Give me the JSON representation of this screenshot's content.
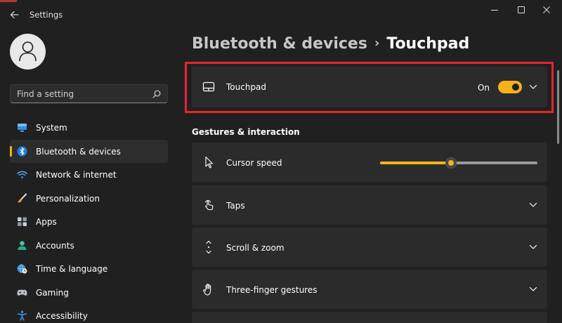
{
  "window": {
    "title": "Settings",
    "back_icon": "back-arrow-icon",
    "controls": [
      "minimize-icon",
      "maximize-icon",
      "close-icon"
    ]
  },
  "sidebar": {
    "avatar_icon": "user-icon",
    "search": {
      "placeholder": "Find a setting",
      "icon": "search-icon"
    },
    "items": [
      {
        "label": "System",
        "icon": "monitor-icon",
        "active": false
      },
      {
        "label": "Bluetooth & devices",
        "icon": "bluetooth-icon",
        "active": true
      },
      {
        "label": "Network & internet",
        "icon": "wifi-icon",
        "active": false
      },
      {
        "label": "Personalization",
        "icon": "brush-icon",
        "active": false
      },
      {
        "label": "Apps",
        "icon": "apps-icon",
        "active": false
      },
      {
        "label": "Accounts",
        "icon": "person-icon",
        "active": false
      },
      {
        "label": "Time & language",
        "icon": "globe-clock-icon",
        "active": false
      },
      {
        "label": "Gaming",
        "icon": "controller-icon",
        "active": false
      },
      {
        "label": "Accessibility",
        "icon": "accessibility-icon",
        "active": false
      }
    ]
  },
  "breadcrumb": {
    "parent": "Bluetooth & devices",
    "separator": "›",
    "current": "Touchpad"
  },
  "main": {
    "touchpad_card": {
      "label": "Touchpad",
      "icon": "touchpad-icon",
      "toggle_state": "On",
      "toggle_on": true
    },
    "section_title": "Gestures & interaction",
    "settings": [
      {
        "label": "Cursor speed",
        "icon": "cursor-icon",
        "control": "slider",
        "slider_value_percent": 45
      },
      {
        "label": "Taps",
        "icon": "tap-icon",
        "control": "expand"
      },
      {
        "label": "Scroll & zoom",
        "icon": "scroll-icon",
        "control": "expand"
      },
      {
        "label": "Three-finger gestures",
        "icon": "hand-icon",
        "control": "expand"
      }
    ]
  },
  "colors": {
    "background": "#202020",
    "card": "#2b2b2b",
    "accent": "#f5b21b",
    "highlight": "#e5262e"
  }
}
